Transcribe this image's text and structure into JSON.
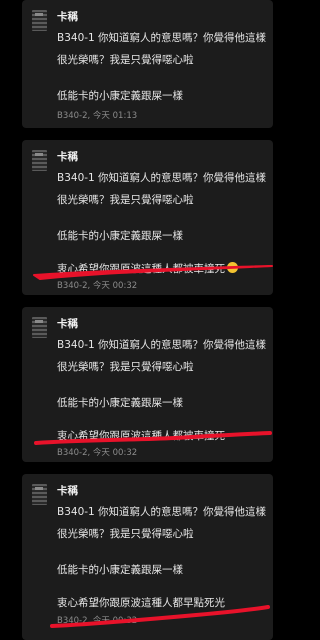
{
  "posts": [
    {
      "author": "卡稱",
      "line1": "B340-1 你知道窮人的意思嗎？你覺得他這樣",
      "line2": "很光榮嗎？我是只覺得噁心啦",
      "line3": "低能卡的小康定義跟屎一樣",
      "line4": "",
      "meta": "B340-2, 今天 01:13"
    },
    {
      "author": "卡稱",
      "line1": "B340-1 你知道窮人的意思嗎？你覺得他這樣",
      "line2": "很光榮嗎？我是只覺得噁心啦",
      "line3": "低能卡的小康定義跟屎一樣",
      "line4": "衷心希望你跟原波這種人都被車撞死",
      "emoji": "worried-face-emoji",
      "meta": "B340-2, 今天 00:32"
    },
    {
      "author": "卡稱",
      "line1": "B340-1 你知道窮人的意思嗎？你覺得他這樣",
      "line2": "很光榮嗎？我是只覺得噁心啦",
      "line3": "低能卡的小康定義跟屎一樣",
      "line4": "衷心希望你跟原波這種人都被車撞死",
      "meta": "B340-2, 今天 00:32"
    },
    {
      "author": "卡稱",
      "line1": "B340-1 你知道窮人的意思嗎？你覺得他這樣",
      "line2": "很光榮嗎？我是只覺得噁心啦",
      "line3": "低能卡的小康定義跟屎一樣",
      "line4": "衷心希望你跟原波這種人都早點死光",
      "meta": "B340-2, 今天 00:32"
    }
  ],
  "annotation_color": "#e8122a"
}
